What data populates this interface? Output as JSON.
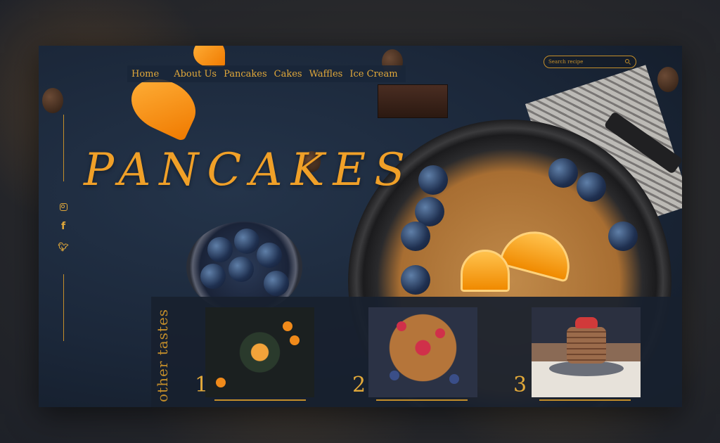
{
  "nav": {
    "items": [
      {
        "label": "Home"
      },
      {
        "label": "About Us"
      },
      {
        "label": "Pancakes"
      },
      {
        "label": "Cakes"
      },
      {
        "label": "Waffles"
      },
      {
        "label": "Ice Cream"
      }
    ]
  },
  "search": {
    "placeholder": "Search recipe"
  },
  "hero": {
    "title": "PANCAKES"
  },
  "social": {
    "icons": [
      "instagram-icon",
      "facebook-icon",
      "twitter-icon"
    ]
  },
  "other_tastes": {
    "title": "other tastes",
    "cards": [
      {
        "number": "1"
      },
      {
        "number": "2"
      },
      {
        "number": "3"
      }
    ]
  },
  "colors": {
    "accent": "#e2a93a",
    "panel": "#18202e",
    "background": "#1b2739"
  }
}
